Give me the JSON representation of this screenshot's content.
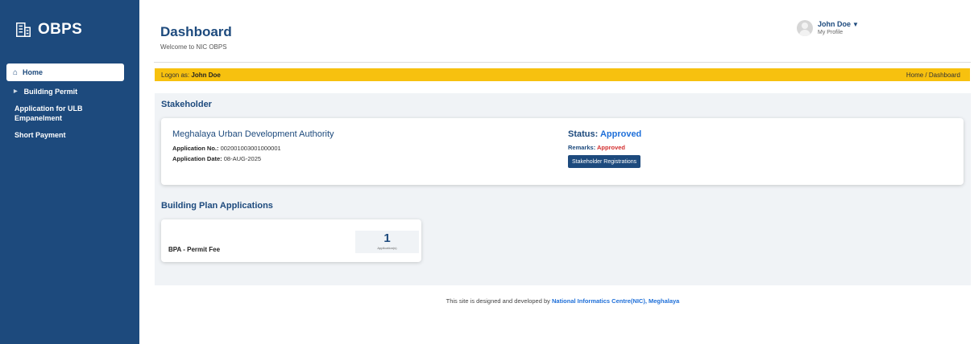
{
  "app": {
    "logo_text": "OBPS",
    "logo_icon": "building-icon"
  },
  "sidebar": {
    "items": [
      {
        "label": "Home",
        "icon": "home-icon",
        "active": true
      },
      {
        "label": "Building Permit",
        "icon": "caret-right-icon"
      },
      {
        "label": "Application for ULB Empanelment"
      },
      {
        "label": "Short Payment"
      }
    ]
  },
  "header": {
    "title": "Dashboard",
    "subtitle": "Welcome to NIC OBPS",
    "user_name": "John Doe",
    "user_profile_label": "My Profile"
  },
  "logon_bar": {
    "prefix": "Logon as: ",
    "user": "John Doe",
    "breadcrumb": "Home / Dashboard",
    "color": "#f7c10f"
  },
  "stakeholder": {
    "section_title": "Stakeholder",
    "org_name": "Meghalaya Urban Development Authority",
    "app_no_label": "Application No.:",
    "app_no": " 002001003001000001",
    "app_date_label": "Application Date:",
    "app_date": " 08-AUG-2025",
    "status_label": "Status: ",
    "status_value": "Approved",
    "remarks_label": "Remarks: ",
    "remarks_value": "Approved",
    "button_label": "Stakeholder Registrations"
  },
  "bpa": {
    "section_title": "Building Plan Applications",
    "card_label": "BPA - Permit Fee",
    "count": "1",
    "count_unit": "Application(s)"
  },
  "footer": {
    "text": "This site is designed and developed by ",
    "link": "National Informatics Centre(NIC), Meghalaya"
  },
  "colors": {
    "primary": "#1d4a7d",
    "accent": "#1e6fd9",
    "danger": "#d32f2f",
    "panel": "#f0f3f6"
  }
}
